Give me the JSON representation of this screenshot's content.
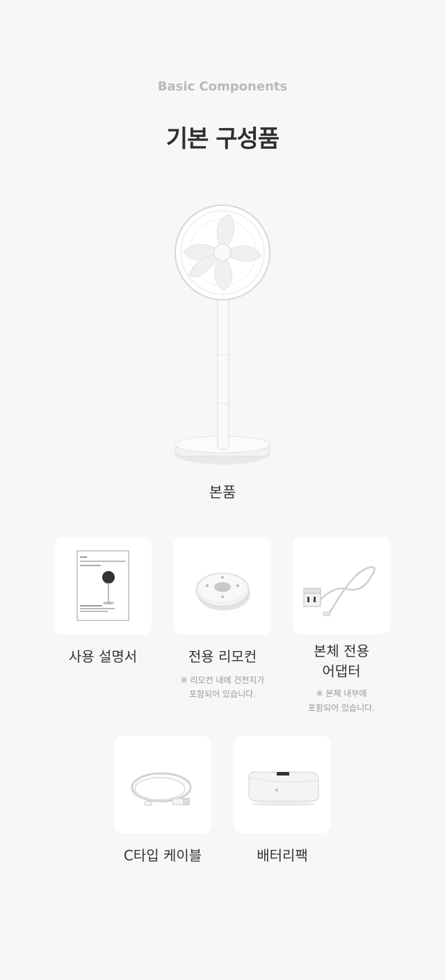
{
  "header": {
    "eyebrow": "Basic Components",
    "title": "기본 구성품"
  },
  "main_product": {
    "label": "본품",
    "icon": "standing-fan-image"
  },
  "row1": [
    {
      "label": "사용 설명서",
      "icon": "manual-image"
    },
    {
      "label": "전용 리모컨",
      "note_line1": "※ 리모컨 내에 건전지가",
      "note_line2": "포함되어 있습니다.",
      "icon": "remote-control-image"
    },
    {
      "label_line1": "본체 전용",
      "label_line2": "어댑터",
      "note_line1": "※ 본체 내부에",
      "note_line2": "포함되어 있습니다.",
      "icon": "adapter-image"
    }
  ],
  "row2": [
    {
      "label": "C타입 케이블",
      "icon": "usb-c-cable-image"
    },
    {
      "label": "배터리팩",
      "icon": "battery-pack-image"
    }
  ],
  "colors": {
    "background": "#f7f7f7",
    "card": "#ffffff",
    "title": "#2f2f2f",
    "eyebrow": "#b9b9b9",
    "note": "#999999"
  }
}
